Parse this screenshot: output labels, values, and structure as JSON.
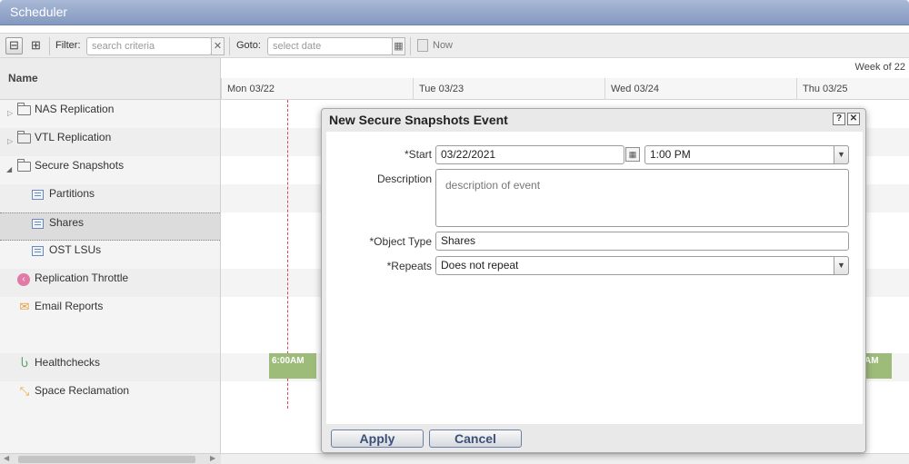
{
  "window": {
    "title": "Scheduler"
  },
  "toolbar": {
    "filter_label": "Filter:",
    "filter_placeholder": "search criteria",
    "goto_label": "Goto:",
    "goto_placeholder": "select date",
    "now_label": "Now",
    "clear_glyph": "✕",
    "date_glyph": "▦"
  },
  "tree": {
    "header": "Name",
    "items": [
      {
        "label": "NAS Replication",
        "icon": "folder-icon",
        "expandable": true
      },
      {
        "label": "VTL Replication",
        "icon": "folder-icon",
        "expandable": true
      },
      {
        "label": "Secure Snapshots",
        "icon": "folder-open-icon",
        "expanded": true
      },
      {
        "label": "Partitions",
        "icon": "list-icon"
      },
      {
        "label": "Shares",
        "icon": "list-icon",
        "selected": true
      },
      {
        "label": "OST LSUs",
        "icon": "list-icon"
      },
      {
        "label": "Replication Throttle",
        "icon": "throttle-icon"
      },
      {
        "label": "Email Reports",
        "icon": "envelope-icon"
      },
      {
        "label": "Healthchecks",
        "icon": "stethoscope-icon"
      },
      {
        "label": "Space Reclamation",
        "icon": "compress-icon"
      }
    ]
  },
  "calendar": {
    "week_label": "Week of 22",
    "days": [
      "Mon 03/22",
      "Tue 03/23",
      "Wed 03/24",
      "Thu 03/25"
    ],
    "events": [
      {
        "label": "6:00AM",
        "row": "Healthchecks",
        "day": "Mon 03/22"
      },
      {
        "label": "AM",
        "row": "Healthchecks",
        "day": "Thu 03/25"
      }
    ]
  },
  "dialog": {
    "title": "New Secure Snapshots Event",
    "help_glyph": "?",
    "close_glyph": "✕",
    "start_label": "*Start",
    "start_date": "03/22/2021",
    "start_time": "1:00 PM",
    "description_label": "Description",
    "description_placeholder": "description of event",
    "object_type_label": "*Object Type",
    "object_type_value": "Shares",
    "repeats_label": "*Repeats",
    "repeats_value": "Does not repeat",
    "apply_label": "Apply",
    "cancel_label": "Cancel"
  },
  "colors": {
    "title_bar": "#8d9fc4",
    "event_green": "#9dbc7a",
    "today_line": "#e0454f",
    "button_text": "#3b4f78"
  }
}
